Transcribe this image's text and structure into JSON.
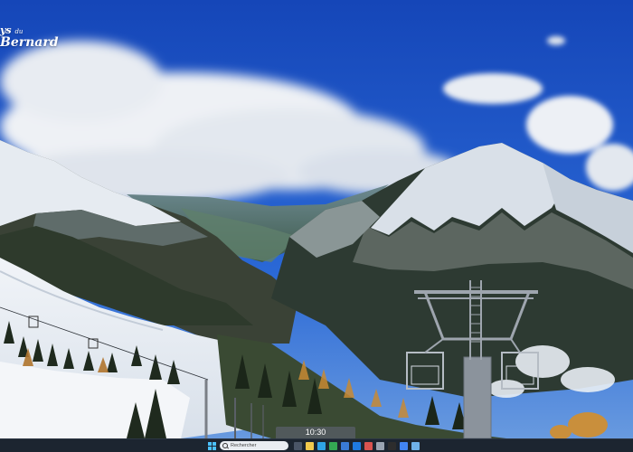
{
  "logo": {
    "line1": "ys",
    "du": "du",
    "line2": "Bernard"
  },
  "time_overlay": "10:30",
  "taskbar": {
    "search_placeholder": "Rechercher",
    "apps": [
      {
        "icon": "task-view-icon",
        "color": "#4a5566"
      },
      {
        "icon": "file-explorer-icon",
        "color": "#f2c94c"
      },
      {
        "icon": "edge-icon",
        "color": "#2fa3e6"
      },
      {
        "icon": "chrome-icon",
        "color": "#34a853"
      },
      {
        "icon": "store-icon",
        "color": "#3a7bd5"
      },
      {
        "icon": "mail-icon",
        "color": "#1f7ae0"
      },
      {
        "icon": "photos-icon",
        "color": "#d9534f"
      },
      {
        "icon": "settings-icon",
        "color": "#9aa4b1"
      },
      {
        "icon": "terminal-icon",
        "color": "#2d2d2d"
      },
      {
        "icon": "calendar-icon",
        "color": "#4285f4"
      },
      {
        "icon": "app-icon",
        "color": "#6fb1e8"
      }
    ]
  }
}
